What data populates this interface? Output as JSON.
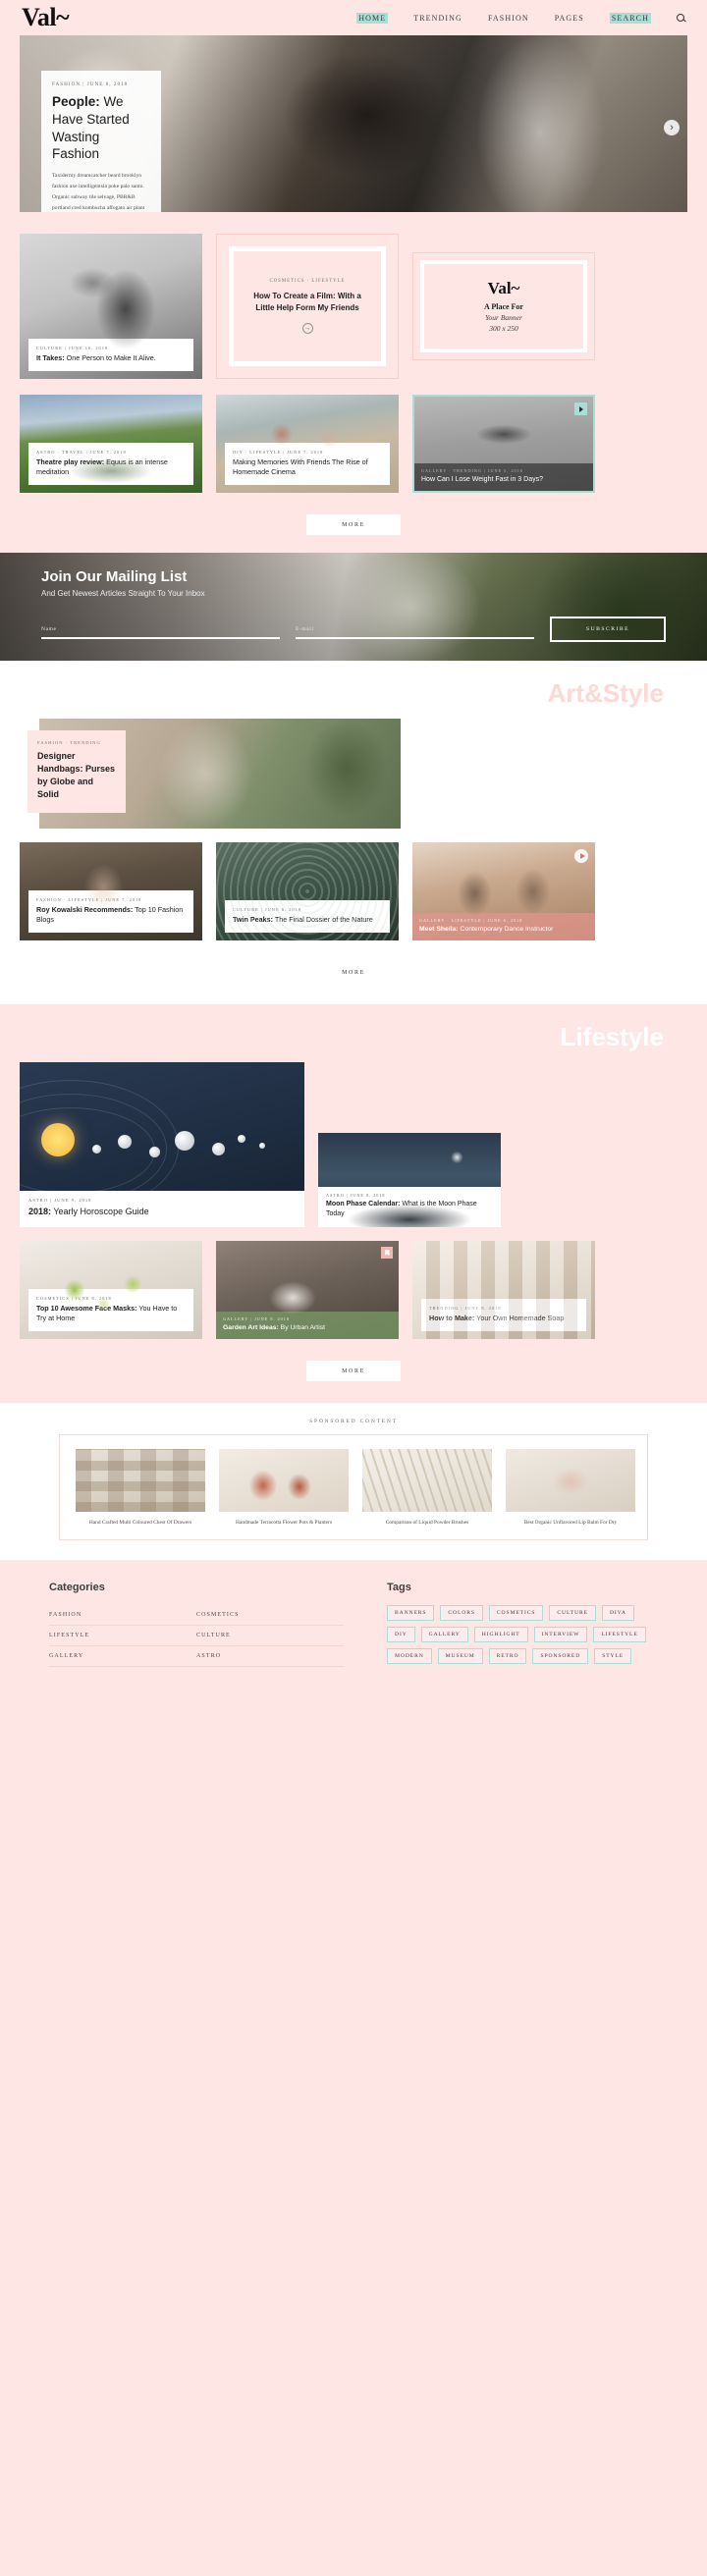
{
  "header": {
    "logo": "Val~",
    "nav": [
      {
        "label": "HOME",
        "highlight": true
      },
      {
        "label": "TRENDING",
        "highlight": false
      },
      {
        "label": "FASHION",
        "highlight": false
      },
      {
        "label": "PAGES",
        "highlight": false
      },
      {
        "label": "SEARCH",
        "highlight": true
      }
    ],
    "search_icon": "search-icon"
  },
  "hero": {
    "meta": "FASHION  |  JUNE 8, 2018",
    "title_bold": "People:",
    "title_rest": " We Have Started Wasting Fashion",
    "paragraph": "Taxidermy dreamcatcher beard brooklyn fashion axe intelligentsia poke palo santo. Organic subway tile selvage, PBR&B portland cred kombucha affogato air plant etsy enamel pin literally salvia pitchfork..."
  },
  "section_a": {
    "dance_card": {
      "meta": "CULTURE  |  JUNE 10, 2018",
      "title_bold": "It Takes:",
      "title_rest": " One Person to Make It Alive."
    },
    "film_card": {
      "meta": "COSMETICS · LIFESTYLE",
      "title": "How To Create a Film: With a Little Help Form My Friends",
      "arrow": "→"
    },
    "banner": {
      "logo": "Val~",
      "line1": "A Place For",
      "line2": "Your Banner",
      "line3": "300 x 250"
    },
    "cards": [
      {
        "meta": "ASTRO · TRAVEL  |  JUNE 7, 2018",
        "title_bold": "Theatre play review:",
        "title_rest": " Equus is an intense meditation"
      },
      {
        "meta": "DIY · LIFESTYLE  |  JUNE 7, 2018",
        "title_bold": "",
        "title_rest": "Making Memories With Friends The Rise of Homemade Cinema"
      },
      {
        "meta": "GALLERY · TRENDING  |  JUNE 5, 2018",
        "title_bold": "",
        "title_rest": "How Can I Lose Weight Fast in 3 Days?"
      }
    ],
    "more_label": "MORE"
  },
  "newsletter": {
    "heading": "Join Our Mailing List",
    "subheading": "And Get Newest Articles Straight To Your Inbox",
    "name_label": "Name",
    "email_label": "E-mail",
    "subscribe_label": "SUBSCRIBE"
  },
  "section_art": {
    "title": "Art&Style",
    "feature": {
      "meta": "FASHION · TRENDING",
      "title": "Designer Handbags: Purses by Globe and Solid"
    },
    "cards": [
      {
        "meta": "FASHION · LIFESTYLE  |  JUNE 7, 2018",
        "title_bold": "Roy Kowalski Recommends:",
        "title_rest": " Top 10 Fashion Blogs"
      },
      {
        "meta": "CULTURE  |  JUNE 6, 2018",
        "title_bold": "Twin Peaks:",
        "title_rest": " The Final Dossier of the Nature"
      },
      {
        "meta": "GALLERY · LIFESTYLE  |  JUNE 6, 2018",
        "title_bold": "Meet Sheila:",
        "title_rest": " Contemporary Dance Instructor"
      }
    ],
    "more_label": "MORE"
  },
  "section_life": {
    "title": "Lifestyle",
    "solar": {
      "meta": "ASTRO  |  JUNE 9, 2018",
      "title_bold": "2018:",
      "title_rest": " Yearly Horoscope Guide"
    },
    "moon": {
      "meta": "ASTRO  |  JUNE 8, 2018",
      "title_bold": "Moon Phase Calendar:",
      "title_rest": " What is the Moon Phase Today"
    },
    "cards": [
      {
        "meta": "COSMETICS  |  JUNE 8, 2018",
        "title_bold": "Top 10 Awesome Face Masks:",
        "title_rest": " You Have to Try at Home"
      },
      {
        "meta": "GALLERY  |  JUNE 8, 2018",
        "title_bold": "Garden Art Ideas:",
        "title_rest": " By Urban Artist"
      },
      {
        "meta": "TRENDING  |  JUNE 8, 2018",
        "title_bold": "How to Make:",
        "title_rest": " Your Own Homemade Soap"
      }
    ],
    "more_label": "MORE"
  },
  "sponsored": {
    "heading": "SPONSORED CONTENT",
    "items": [
      {
        "caption": "Hand Crafted Multi Coloured Chest Of Drawers"
      },
      {
        "caption": "Handmade Terracotta Flower Pots & Planters"
      },
      {
        "caption": "Comparison of Liquid Powder Brushes"
      },
      {
        "caption": "Best Organic Unflavored Lip Balm For Dry"
      }
    ]
  },
  "footer": {
    "categories_heading": "Categories",
    "category_rows": [
      [
        "FASHION",
        "COSMETICS"
      ],
      [
        "LIFESTYLE",
        "CULTURE"
      ],
      [
        "GALLERY",
        "ASTRO"
      ]
    ],
    "tags_heading": "Tags",
    "tags": [
      "BANNERS",
      "COLORS",
      "COSMETICS",
      "CULTURE",
      "DIVA",
      "DIY",
      "GALLERY",
      "HIGHLIGHT",
      "INTERVIEW",
      "LIFESTYLE",
      "MODERN",
      "MUSEUM",
      "RETRO",
      "SPONSORED",
      "STYLE"
    ]
  },
  "colors": {
    "page_bg": "#fde6e3",
    "accent_mint": "#a8ded6",
    "section_title": "#fbd9d4",
    "white": "#ffffff"
  }
}
